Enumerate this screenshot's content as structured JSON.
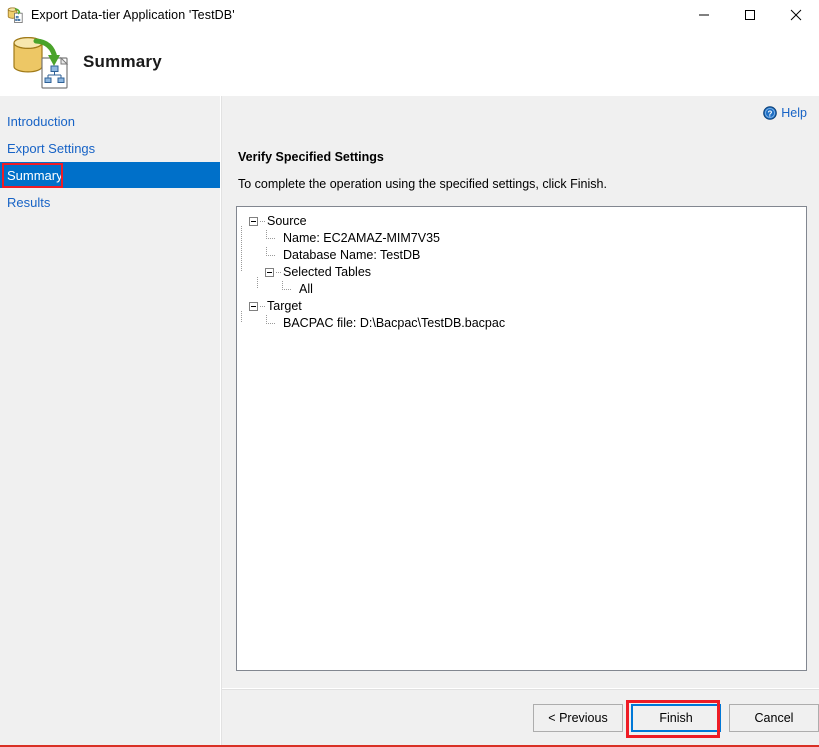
{
  "window": {
    "title": "Export Data-tier Application 'TestDB'",
    "icon": "export-data-tier-app-icon",
    "controls": {
      "minimize": "minimize-icon",
      "maximize": "maximize-icon",
      "close": "close-icon"
    }
  },
  "banner": {
    "icon": "database-export-bacpac-icon",
    "title": "Summary"
  },
  "sidebar": {
    "items": [
      {
        "label": "Introduction",
        "selected": false
      },
      {
        "label": "Export Settings",
        "selected": false
      },
      {
        "label": "Summary",
        "selected": true
      },
      {
        "label": "Results",
        "selected": false
      }
    ]
  },
  "content": {
    "help": {
      "label": "Help",
      "icon": "help-circle-icon"
    },
    "heading": "Verify Specified Settings",
    "subtext": "To complete the operation using the specified settings, click Finish.",
    "tree": [
      {
        "level": 0,
        "label": "Source",
        "expander": true
      },
      {
        "level": 1,
        "label": "Name: EC2AMAZ-MIM7V35",
        "expander": false
      },
      {
        "level": 1,
        "label": "Database Name: TestDB",
        "expander": false
      },
      {
        "level": 1,
        "label": "Selected Tables",
        "expander": true
      },
      {
        "level": 2,
        "label": "All",
        "expander": false
      },
      {
        "level": 0,
        "label": "Target",
        "expander": true
      },
      {
        "level": 1,
        "label": "BACPAC file: D:\\Bacpac\\TestDB.bacpac",
        "expander": false
      }
    ]
  },
  "footer": {
    "previous_label": "< Previous",
    "finish_label": "Finish",
    "cancel_label": "Cancel"
  },
  "annotations": {
    "summary_highlight_color": "#ee1c25",
    "finish_highlight_color": "#ee1c25",
    "bottom_rule_color": "#d93025",
    "selection_color": "#0070c9",
    "link_color": "#1763c6",
    "focus_border_color": "#0078d7"
  }
}
